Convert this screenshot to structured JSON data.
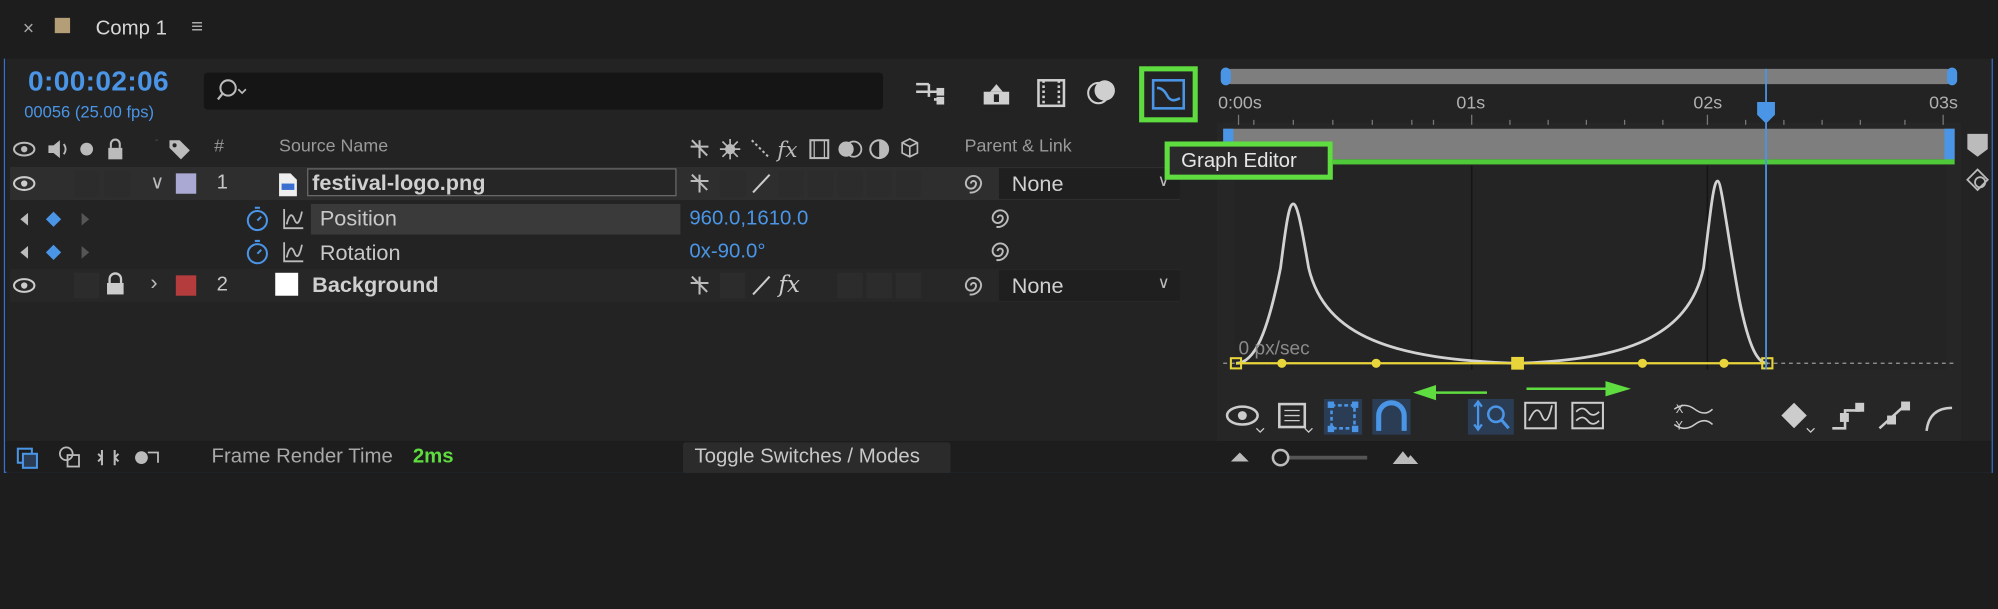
{
  "tab": {
    "close": "×",
    "title": "Comp 1",
    "menu": "≡",
    "swatch_color": "#b39e78"
  },
  "timecode": {
    "current": "0:00:02:06",
    "frames": "00056 (25.00 fps)"
  },
  "search": {
    "placeholder": ""
  },
  "columns": {
    "hash": "#",
    "source_name": "Source Name",
    "parent_link": "Parent & Link"
  },
  "layers": [
    {
      "index": "1",
      "name": "festival-logo.png",
      "parent": "None",
      "label_color": "#a9a9d4",
      "twirl": "∨"
    },
    {
      "index": "2",
      "name": "Background",
      "parent": "None",
      "label_color": "#b43c3c",
      "twirl": "›"
    }
  ],
  "properties": [
    {
      "name": "Position",
      "value": "960.0,1610.0"
    },
    {
      "name": "Rotation",
      "value": "0x-90.0°"
    }
  ],
  "timeline": {
    "ruler_labels": [
      "0:00s",
      "01s",
      "02s",
      "03s"
    ],
    "graph_unit_label": "0 px/sec"
  },
  "tooltip": {
    "text": "Graph Editor"
  },
  "bottom": {
    "frame_render_label": "Frame Render Time",
    "frame_render_value": "2ms",
    "toggle_label": "Toggle Switches / Modes"
  },
  "colors": {
    "accent_blue": "#4a95e6",
    "highlight_green": "#5fdc3f",
    "keyframe_yellow": "#e8d53c"
  }
}
